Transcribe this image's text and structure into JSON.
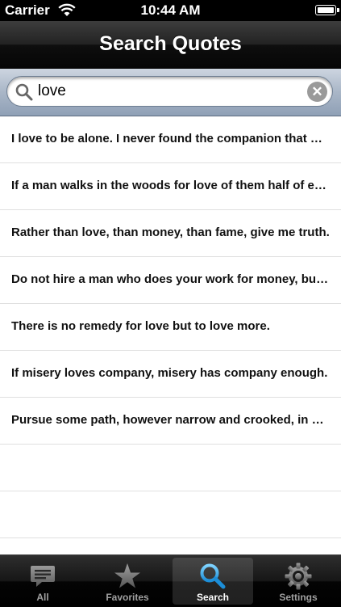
{
  "status_bar": {
    "carrier": "Carrier",
    "time": "10:44 AM"
  },
  "nav": {
    "title": "Search Quotes"
  },
  "search": {
    "value": "love",
    "placeholder": ""
  },
  "results": [
    "I love to be alone. I never found the companion that was so companionable as solitude.",
    "If a man walks in the woods for love of them half of each day, he is in danger of being regarded as a loafer.",
    "Rather than love, than money, than fame, give me truth.",
    "Do not hire a man who does your work for money, but him who does it for love of it.",
    "There is no remedy for love but to love more.",
    "If misery loves company, misery has company enough.",
    "Pursue some path, however narrow and crooked, in which you can walk with love and reverence."
  ],
  "tabs": [
    {
      "label": "All",
      "icon": "speech-bubble-icon",
      "active": false
    },
    {
      "label": "Favorites",
      "icon": "star-icon",
      "active": false
    },
    {
      "label": "Search",
      "icon": "search-icon",
      "active": true
    },
    {
      "label": "Settings",
      "icon": "gear-icon",
      "active": false
    }
  ]
}
